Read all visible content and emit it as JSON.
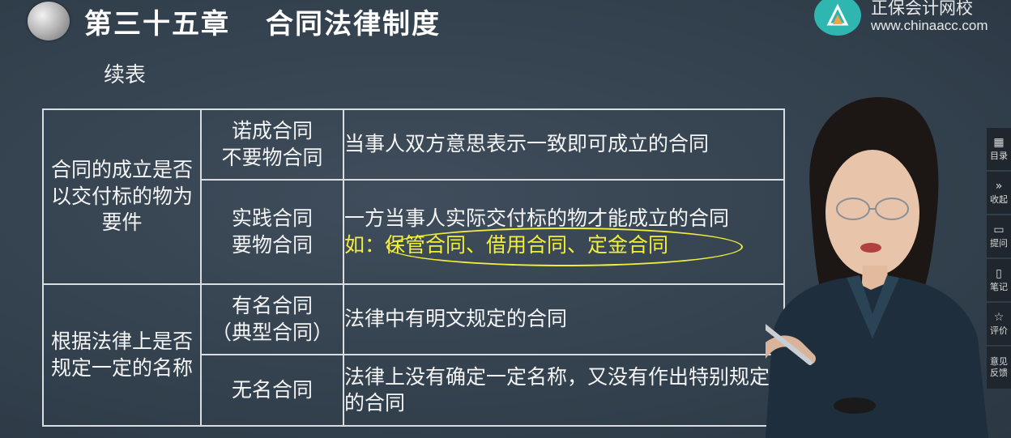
{
  "header": {
    "chapter_no": "第三十五章",
    "chapter_title": "合同法律制度",
    "brand_name": "正保会计网校",
    "brand_url": "www.chinaacc.com"
  },
  "subtitle": "续表",
  "table": {
    "group1": {
      "category": "合同的成立是否以交付标的物为要件",
      "row1": {
        "type": "诺成合同\n不要物合同",
        "definition": "当事人双方意思表示一致即可成立的合同"
      },
      "row2": {
        "type": "实践合同\n要物合同",
        "definition": "一方当事人实际交付标的物才能成立的合同",
        "example_prefix": "如：",
        "example_items": "保管合同、借用合同、定金合同"
      }
    },
    "group2": {
      "category": "根据法律上是否规定一定的名称",
      "row1": {
        "type": "有名合同\n（典型合同）",
        "definition": "法律中有明文规定的合同"
      },
      "row2": {
        "type": "无名合同",
        "definition": "法律上没有确定一定名称，又没有作出特别规定的合同"
      }
    }
  },
  "side_panel": {
    "items": [
      {
        "icon": "grid-icon",
        "label": "目录"
      },
      {
        "icon": "double-chevron-right-icon",
        "label": "收起"
      },
      {
        "icon": "question-bubble-icon",
        "label": "提问"
      },
      {
        "icon": "note-icon",
        "label": "笔记"
      },
      {
        "icon": "star-icon",
        "label": "评价"
      },
      {
        "icon": "feedback-icon",
        "label": "意见\n反馈"
      }
    ]
  },
  "colors": {
    "background": "#34424f",
    "highlight": "#f3ee3c",
    "logo": "#2fb6b1",
    "panel": "#1f262d"
  }
}
